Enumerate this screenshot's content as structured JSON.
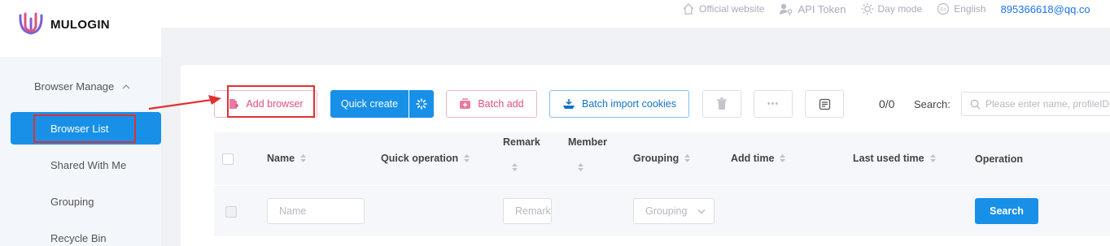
{
  "brand": {
    "name": "MULOGIN"
  },
  "topnav": {
    "official_website": "Official website",
    "api_token": "API Token",
    "day_mode": "Day mode",
    "language": "English",
    "email": "895366618@qq.co"
  },
  "sidebar": {
    "group_label": "Browser Manage",
    "items": [
      {
        "label": "Browser List",
        "active": true
      },
      {
        "label": "Shared With Me"
      },
      {
        "label": "Grouping"
      },
      {
        "label": "Recycle Bin"
      }
    ]
  },
  "toolbar": {
    "add_browser": "Add browser",
    "quick_create": "Quick create",
    "batch_add": "Batch add",
    "batch_import_cookies": "Batch import cookies",
    "more": "•••",
    "count": "0/0",
    "search_label": "Search:",
    "search_placeholder": "Please enter name, profileID"
  },
  "table": {
    "columns": [
      "Name",
      "Quick operation",
      "Remark",
      "Member",
      "Grouping",
      "Add time",
      "Last used time",
      "Operation"
    ]
  },
  "filters": {
    "name_placeholder": "Name",
    "remark_placeholder": "Remark",
    "grouping_placeholder": "Grouping",
    "search_button": "Search"
  },
  "colors": {
    "primary": "#1890e8",
    "pink": "#e0507c",
    "annotation": "#e03030"
  }
}
